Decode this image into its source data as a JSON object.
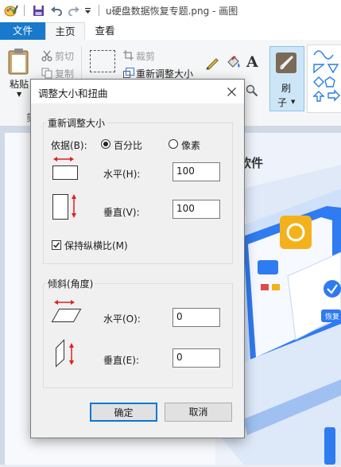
{
  "window": {
    "title": "u硬盘数据恢复专题.png - 画图"
  },
  "tabs": [
    {
      "label": "文件"
    },
    {
      "label": "主页"
    },
    {
      "label": "查看"
    }
  ],
  "ribbon": {
    "paste_label": "粘贴",
    "cut_label": "剪切",
    "copy_label": "复制",
    "clipboard_group_partial": "剪",
    "crop_label": "裁剪",
    "resize_label": "重新调整大小",
    "brushes_label_top": "刷",
    "brushes_label_bottom": "子",
    "text_tool": "A"
  },
  "canvas": {
    "heading_fragment": "软件",
    "card_text": "恢复"
  },
  "dialog": {
    "title": "调整大小和扭曲",
    "resize_group": {
      "title": "重新调整大小",
      "by_label": "依据(B):",
      "percent_label": "百分比",
      "pixels_label": "像素",
      "selected": "percent",
      "horizontal_label": "水平(H):",
      "horizontal_value": "100",
      "vertical_label": "垂直(V):",
      "vertical_value": "100",
      "maintain_aspect_label": "保持纵横比(M)",
      "maintain_aspect_checked": true
    },
    "skew_group": {
      "title": "倾斜(角度)",
      "horizontal_label": "水平(O):",
      "horizontal_value": "0",
      "vertical_label": "垂直(E):",
      "vertical_value": "0"
    },
    "ok_label": "确定",
    "cancel_label": "取消"
  },
  "colors": {
    "accent": "#1979ca",
    "arrow_red": "#e02020",
    "ok_border": "#0078d7"
  }
}
